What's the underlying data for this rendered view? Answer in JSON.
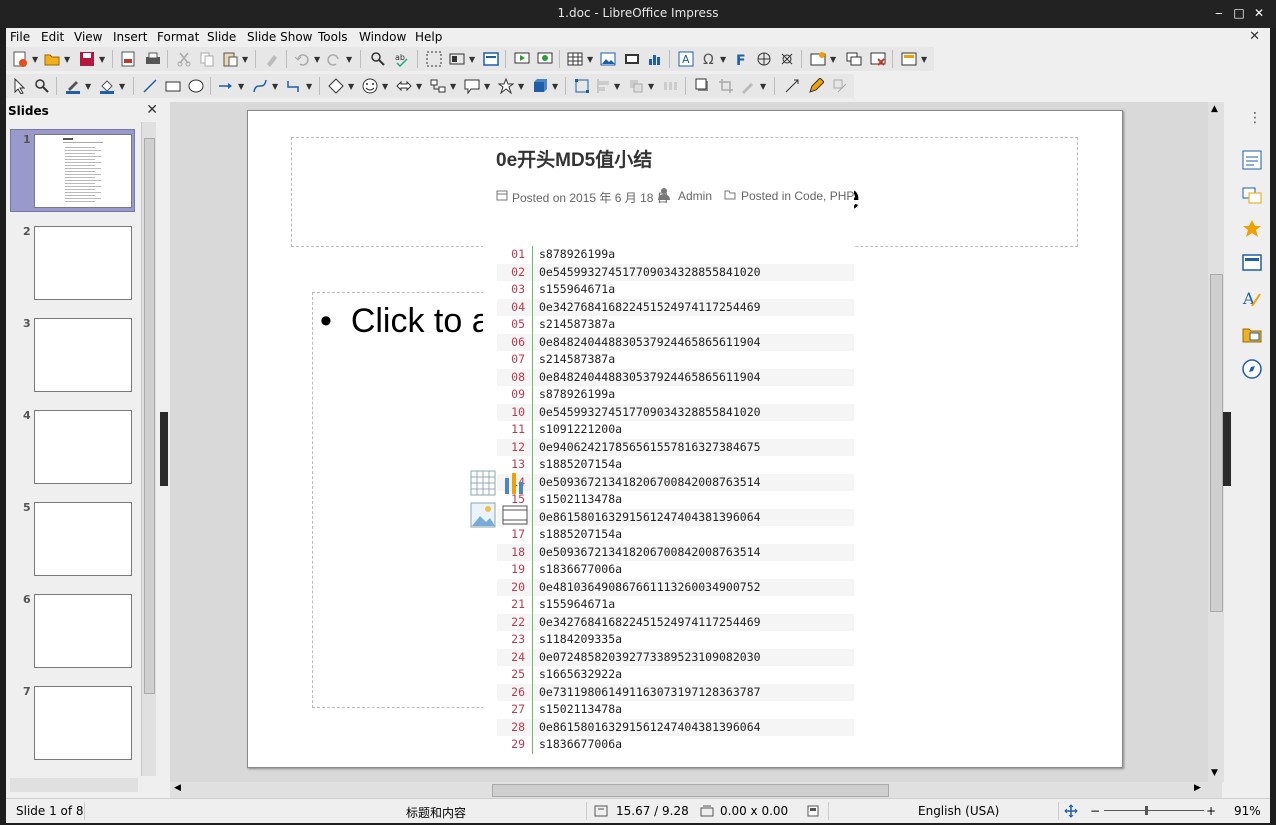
{
  "window": {
    "title": "1.doc - LibreOffice Impress"
  },
  "menu": [
    "File",
    "Edit",
    "View",
    "Insert",
    "Format",
    "Slide",
    "Slide Show",
    "Tools",
    "Window",
    "Help"
  ],
  "slides_panel": {
    "title": "Slides",
    "count": 7,
    "numbers": [
      "1",
      "2",
      "3",
      "4",
      "5",
      "6",
      "7"
    ]
  },
  "slide": {
    "title_fragment": "e",
    "body_text": "Click to a",
    "bullet": "•"
  },
  "pasted_image": {
    "title": "0e开头MD5值小结",
    "posted_on": "Posted on 2015 年 6 月 18 日",
    "author": "Admin",
    "posted_in": "Posted in Code, PHP",
    "lines": [
      {
        "n": "01",
        "v": "s878926199a"
      },
      {
        "n": "02",
        "v": "0e545993274517709034328855841020"
      },
      {
        "n": "03",
        "v": "s155964671a"
      },
      {
        "n": "04",
        "v": "0e342768416822451524974117254469"
      },
      {
        "n": "05",
        "v": "s214587387a"
      },
      {
        "n": "06",
        "v": "0e848240448830537924465865611904"
      },
      {
        "n": "07",
        "v": "s214587387a"
      },
      {
        "n": "08",
        "v": "0e848240448830537924465865611904"
      },
      {
        "n": "09",
        "v": "s878926199a"
      },
      {
        "n": "10",
        "v": "0e545993274517709034328855841020"
      },
      {
        "n": "11",
        "v": "s1091221200a"
      },
      {
        "n": "12",
        "v": "0e940624217856561557816327384675"
      },
      {
        "n": "13",
        "v": "s1885207154a"
      },
      {
        "n": "14",
        "v": "0e509367213418206700842008763514"
      },
      {
        "n": "15",
        "v": "s1502113478a"
      },
      {
        "n": "16",
        "v": "0e861580163291561247404381396064"
      },
      {
        "n": "17",
        "v": "s1885207154a"
      },
      {
        "n": "18",
        "v": "0e509367213418206700842008763514"
      },
      {
        "n": "19",
        "v": "s1836677006a"
      },
      {
        "n": "20",
        "v": "0e481036490867661113260034900752"
      },
      {
        "n": "21",
        "v": "s155964671a"
      },
      {
        "n": "22",
        "v": "0e342768416822451524974117254469"
      },
      {
        "n": "23",
        "v": "s1184209335a"
      },
      {
        "n": "24",
        "v": "0e072485820392773389523109082030"
      },
      {
        "n": "25",
        "v": "s1665632922a"
      },
      {
        "n": "26",
        "v": "0e731198061491163073197128363787"
      },
      {
        "n": "27",
        "v": "s1502113478a"
      },
      {
        "n": "28",
        "v": "0e861580163291561247404381396064"
      },
      {
        "n": "29",
        "v": "s1836677006a"
      }
    ]
  },
  "status": {
    "slide_of": "Slide 1 of 8",
    "layout": "标题和内容",
    "position": "15.67 / 9.28",
    "size": "0.00 x 0.00",
    "language": "English (USA)",
    "zoom": "91%"
  },
  "colors": {
    "selection": "#9999cc",
    "line_number": "#c0394b",
    "gutter": "#6fba6f"
  }
}
